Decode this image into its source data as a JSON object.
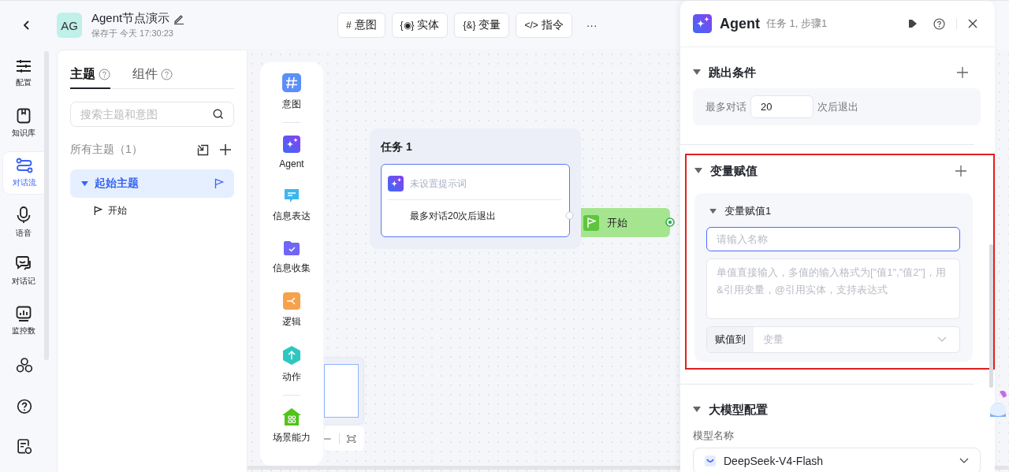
{
  "nav_items": [
    {
      "label": "配置",
      "selected": false
    },
    {
      "label": "知识库",
      "selected": false
    },
    {
      "label": "对话流",
      "selected": true
    },
    {
      "label": "语音",
      "selected": false
    },
    {
      "label": "对话记",
      "selected": false
    },
    {
      "label": "监控数",
      "selected": false
    }
  ],
  "header": {
    "avatar": "AG",
    "title": "Agent节点演示",
    "saved": "保存于 今天 17:30:23"
  },
  "toolbar": [
    {
      "glyph": "#",
      "label": "意图"
    },
    {
      "glyph": "{◉}",
      "label": "实体"
    },
    {
      "glyph": "{&}",
      "label": "变量"
    },
    {
      "glyph": "</>",
      "label": "指令"
    }
  ],
  "toolbar_more": "···",
  "left_panel": {
    "tabs": [
      {
        "label": "主题",
        "selected": true
      },
      {
        "label": "组件",
        "selected": false
      }
    ],
    "search": {
      "placeholder": "搜索主题和意图"
    },
    "all_topics": "所有主题（1）",
    "tree": [
      {
        "label": "起始主题",
        "selected": true,
        "expanded": true,
        "children": [
          {
            "label": "开始",
            "selected": false
          }
        ]
      }
    ]
  },
  "palette": [
    "意图",
    "Agent",
    "信息表达",
    "信息收集",
    "逻辑",
    "动作",
    "场景能力"
  ],
  "task_node": {
    "title": "任务 1",
    "prompt_placeholder": "未设置提示词",
    "exit_rule": "最多对话20次后退出"
  },
  "start_node": {
    "label": "开始"
  },
  "panel": {
    "title": "Agent",
    "subtitle": "任务 1, 步骤1",
    "exit_condition": {
      "title": "跳出条件",
      "expanded": true,
      "prefix": "最多对话",
      "value": "20",
      "suffix": "次后退出"
    },
    "assignment": {
      "title": "变量赋值",
      "expanded": true,
      "highlighted": true,
      "items": [
        {
          "title": "变量赋值1",
          "expanded": true,
          "name_placeholder": "请输入名称",
          "value_placeholder": "单值直接输入，多值的输入格式为[\"值1\",\"值2\"]，用&引用变量，@引用实体，支持表达式",
          "target_label": "赋值到",
          "target_placeholder": "变量"
        }
      ]
    },
    "llm": {
      "title": "大模型配置",
      "expanded": true,
      "model_label": "模型名称",
      "model": "DeepSeek-V4-Flash"
    }
  }
}
